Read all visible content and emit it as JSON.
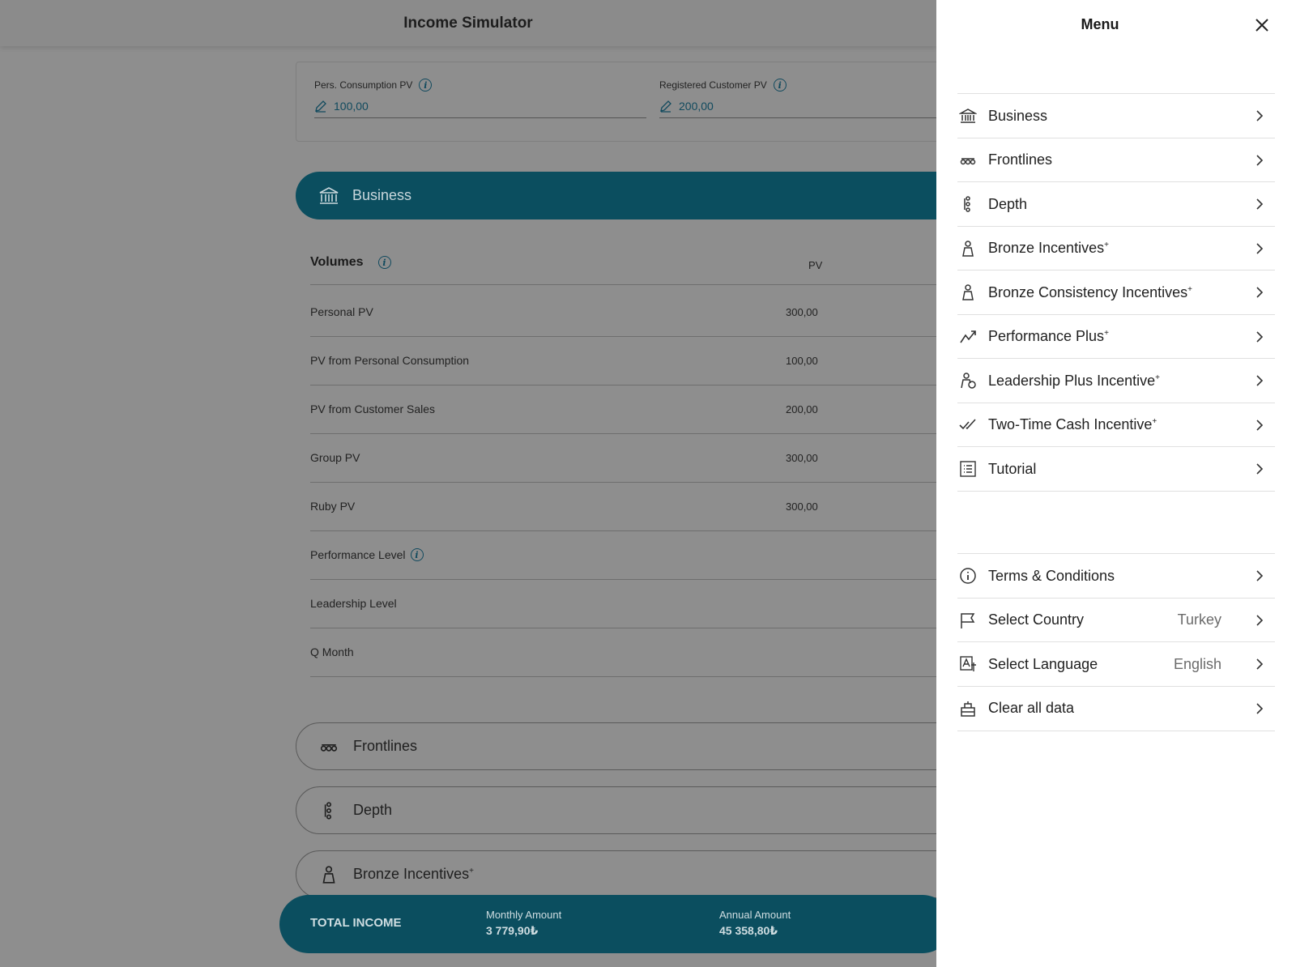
{
  "app": {
    "title": "Income Simulator"
  },
  "inputs": {
    "pers_consumption": {
      "label": "Pers. Consumption PV",
      "value": "100,00"
    },
    "registered_customer": {
      "label": "Registered Customer PV",
      "value": "200,00"
    }
  },
  "business_section": {
    "label": "Business"
  },
  "volumes": {
    "title": "Volumes",
    "column": "PV",
    "rows": [
      {
        "label": "Personal PV",
        "value": "300,00"
      },
      {
        "label": "PV from Personal Consumption",
        "value": "100,00"
      },
      {
        "label": "PV from Customer Sales",
        "value": "200,00"
      },
      {
        "label": "Group PV",
        "value": "300,00"
      },
      {
        "label": "Ruby PV",
        "value": "300,00"
      },
      {
        "label": "Performance Level",
        "value": ""
      },
      {
        "label": "Leadership Level",
        "value": ""
      },
      {
        "label": "Q Month",
        "value": ""
      }
    ]
  },
  "sections": [
    {
      "label": "Frontlines",
      "icon": "frontlines-icon"
    },
    {
      "label": "Depth",
      "icon": "depth-icon"
    },
    {
      "label": "Bronze Incentives",
      "sup": "+",
      "icon": "person-icon"
    }
  ],
  "total": {
    "label": "TOTAL INCOME",
    "monthly_label": "Monthly Amount",
    "monthly_value": "3 779,90₺",
    "annual_label": "Annual Amount",
    "annual_value": "45 358,80₺"
  },
  "menu": {
    "title": "Menu",
    "items": [
      {
        "label": "Business",
        "sup": "",
        "icon": "bank-icon"
      },
      {
        "label": "Frontlines",
        "sup": "",
        "icon": "frontlines-icon"
      },
      {
        "label": "Depth",
        "sup": "",
        "icon": "depth-icon"
      },
      {
        "label": "Bronze Incentives",
        "sup": "+",
        "icon": "person-icon"
      },
      {
        "label": "Bronze Consistency Incentives",
        "sup": "+",
        "icon": "person-icon"
      },
      {
        "label": "Performance Plus",
        "sup": "+",
        "icon": "trend-icon"
      },
      {
        "label": "Leadership Plus Incentive",
        "sup": "+",
        "icon": "person-star-icon"
      },
      {
        "label": "Two-Time Cash Incentive",
        "sup": "+",
        "icon": "double-check-icon"
      },
      {
        "label": "Tutorial",
        "sup": "",
        "icon": "list-icon"
      }
    ],
    "settings": [
      {
        "label": "Terms & Conditions",
        "value": "",
        "icon": "info-icon"
      },
      {
        "label": "Select Country",
        "value": "Turkey",
        "icon": "flag-icon"
      },
      {
        "label": "Select Language",
        "value": "English",
        "icon": "language-icon"
      },
      {
        "label": "Clear all data",
        "value": "",
        "icon": "clear-icon"
      }
    ]
  }
}
